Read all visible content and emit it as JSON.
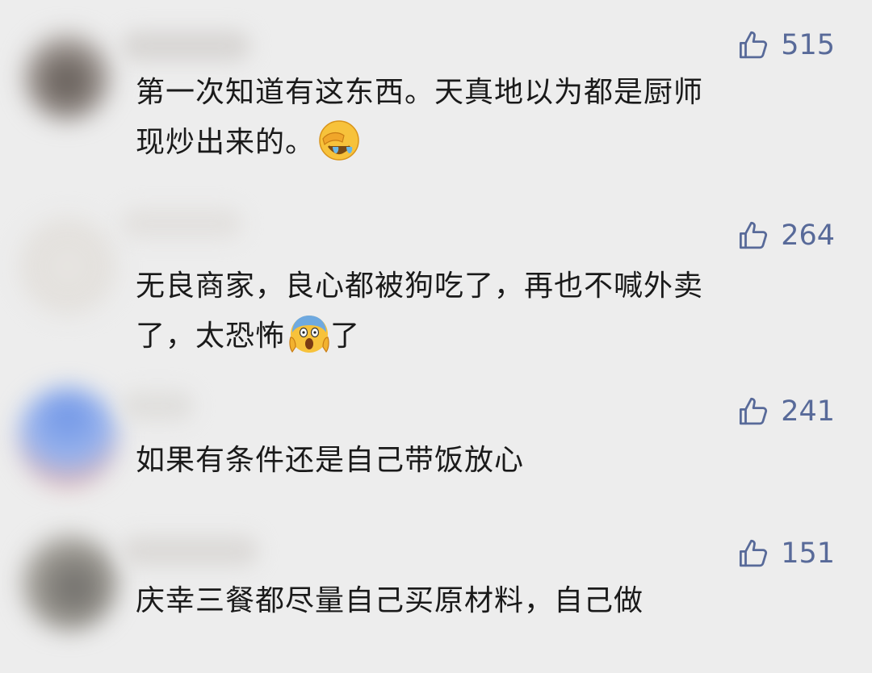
{
  "comments": [
    {
      "likes": "515",
      "line1": "第一次知道有这东西。天真地以为都是厨师",
      "line2": "现炒出来的。",
      "emoji": "face-with-hand-over-eyes-crying-emoji",
      "line2_after": ""
    },
    {
      "likes": "264",
      "line1": "无良商家，良心都被狗吃了，再也不喊外卖",
      "line2": "了，太恐怖",
      "emoji": "face-screaming-in-fear-emoji",
      "line2_after": "了"
    },
    {
      "likes": "241",
      "line1": "如果有条件还是自己带饭放心"
    },
    {
      "likes": "151",
      "line1": "庆幸三餐都尽量自己买原材料，自己做"
    }
  ],
  "icons": {
    "like": "thumbs-up-icon"
  },
  "colors": {
    "background": "#ededed",
    "like_color": "#586a99",
    "text_color": "#1a1a1a"
  }
}
